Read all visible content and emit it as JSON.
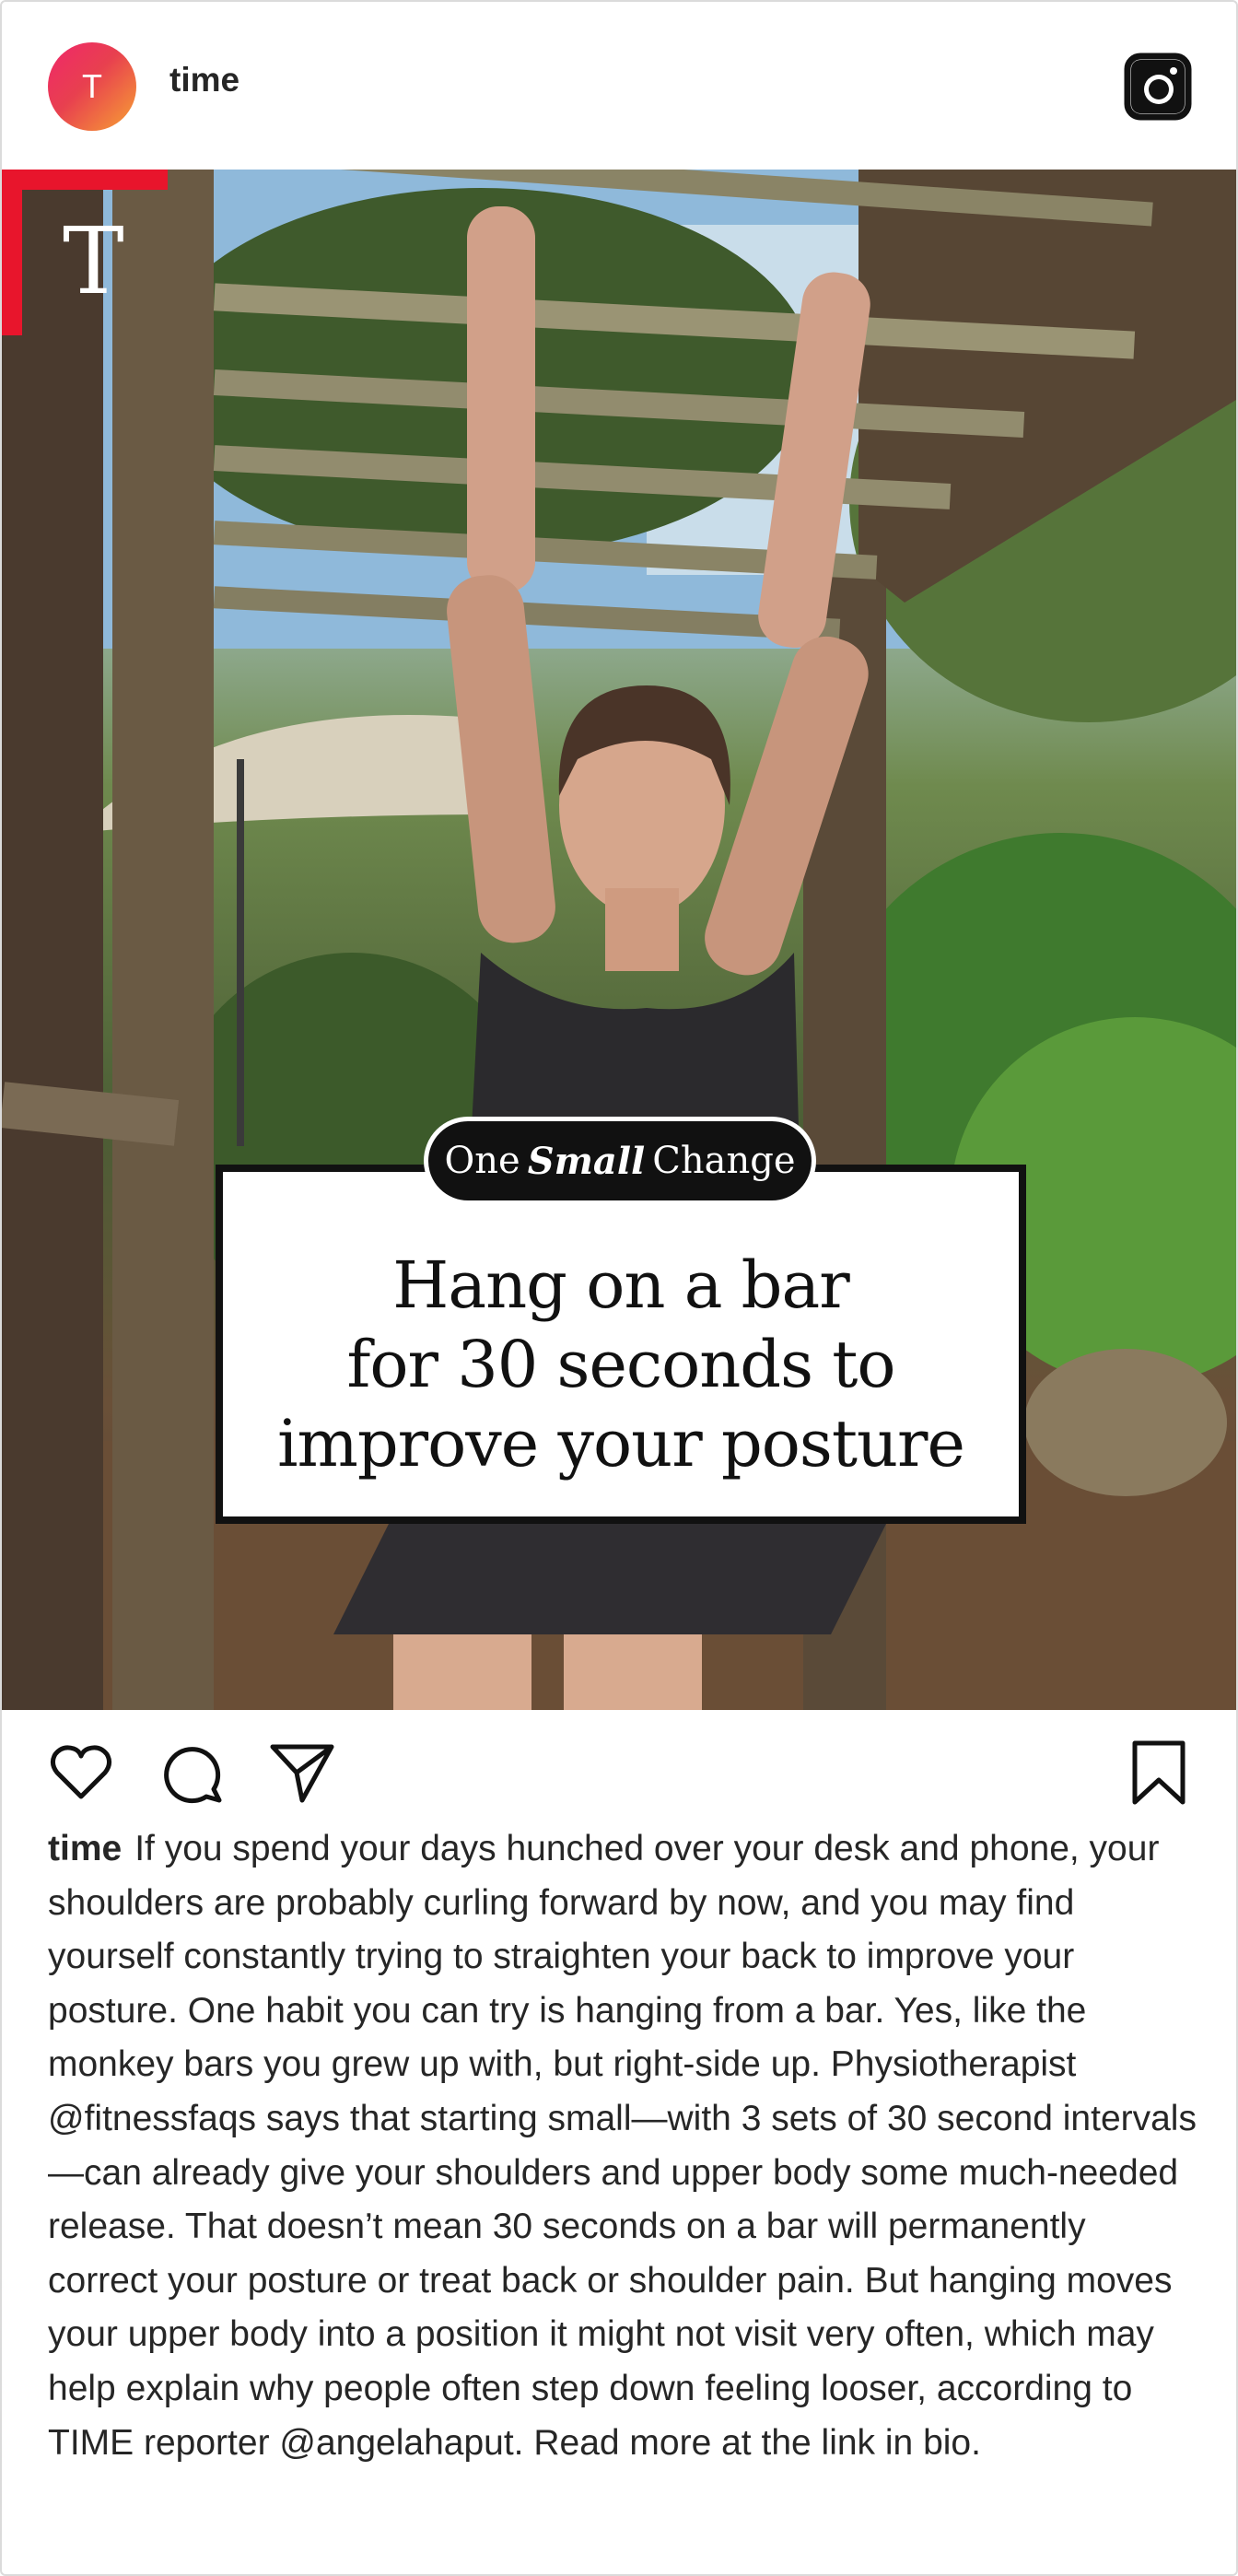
{
  "header": {
    "avatar_letter": "T",
    "username": "time",
    "instagram_icon": "instagram-logo-icon"
  },
  "media": {
    "brand_mark": "T",
    "accent_color": "#e8152c",
    "tag": {
      "prefix": "One",
      "emphasis": "Small",
      "suffix": "Change"
    },
    "headline": [
      "Hang on a bar",
      "for 30 seconds to",
      "improve your posture"
    ]
  },
  "actions": {
    "like_icon": "heart-icon",
    "comment_icon": "comment-icon",
    "share_icon": "send-icon",
    "save_icon": "bookmark-icon"
  },
  "caption": {
    "username": "time",
    "text": "If you spend your days hunched over your desk and phone, your shoulders are probably curling forward by now, and you may find yourself constantly trying to straighten your back to improve your posture. One habit you can try is hanging from a bar. Yes, like the monkey bars you grew up with, but right-side up. Physiotherapist @fitnessfaqs says that starting small—with 3 sets of 30 second intervals—can already give your shoulders and upper body some much-needed release. That doesn’t mean 30 seconds on a bar will permanently correct your posture or treat back or shoulder pain. But hanging moves your upper body into a position it might not visit very often, which may help explain why people often step down feeling looser, according to TIME reporter @angelahaput. Read more at the link in bio."
  }
}
